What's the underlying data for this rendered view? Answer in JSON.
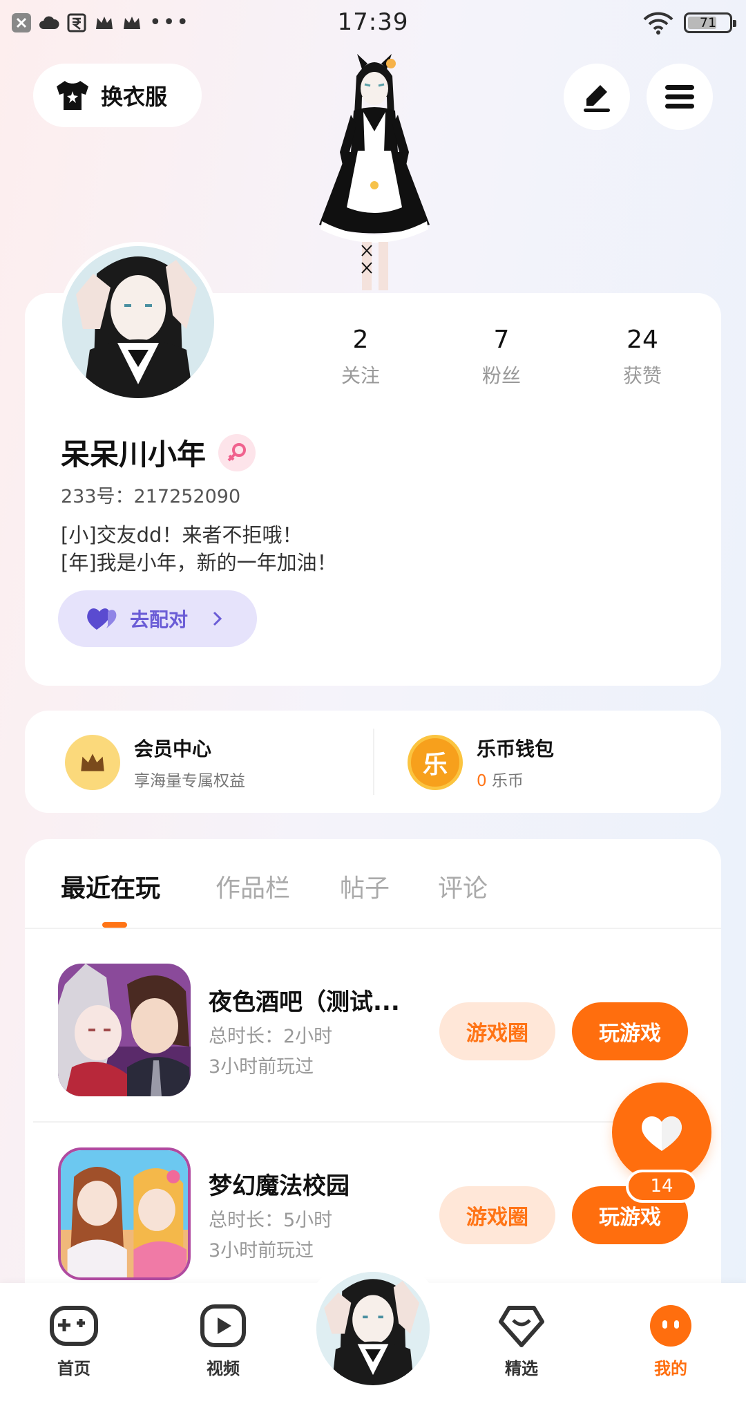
{
  "status_bar": {
    "time": "17:39",
    "battery": "71",
    "battery_level": 0.71,
    "left_icons": [
      "close-icon",
      "cloud-icon",
      "rupee-icon",
      "crown-icon",
      "crown-icon"
    ],
    "overflow": "•••"
  },
  "top": {
    "outfit_label": "换衣服",
    "edit_icon": "pencil-icon",
    "menu_icon": "menu-icon"
  },
  "profile": {
    "stats": [
      {
        "value": "2",
        "label": "关注"
      },
      {
        "value": "7",
        "label": "粉丝"
      },
      {
        "value": "24",
        "label": "获赞"
      }
    ],
    "nickname": "呆呆川小年",
    "gender_icon": "female-icon",
    "user_id": "233号：217252090",
    "bio_line1": "[小]交友dd！来者不拒哦！",
    "bio_line2": "[年]我是小年，新的一年加油！",
    "match_label": "去配对"
  },
  "member": {
    "vip_title": "会员中心",
    "vip_sub": "享海量专属权益",
    "wallet_title": "乐币钱包",
    "wallet_icon_text": "乐",
    "wallet_amount": "0",
    "wallet_unit": "乐币"
  },
  "tabs": [
    "最近在玩",
    "作品栏",
    "帖子",
    "评论"
  ],
  "games": [
    {
      "title": "夜色酒吧（测试...",
      "duration": "总时长：2小时",
      "last_played": "3小时前玩过",
      "circle_label": "游戏圈",
      "play_label": "玩游戏"
    },
    {
      "title": "梦幻魔法校园",
      "duration": "总时长：5小时",
      "last_played": "3小时前玩过",
      "circle_label": "游戏圈",
      "play_label": "玩游戏"
    }
  ],
  "like": {
    "count": "14"
  },
  "nav": [
    {
      "label": "首页",
      "icon": "gamepad-icon"
    },
    {
      "label": "视频",
      "icon": "play-icon"
    },
    {
      "label": "",
      "icon": "avatar"
    },
    {
      "label": "精选",
      "icon": "heart-diamond-icon"
    },
    {
      "label": "我的",
      "icon": "face-icon"
    }
  ],
  "colors": {
    "accent": "#ff6e0e",
    "accent_light": "#ffe7d8",
    "match_bg": "#e6e3fb",
    "match_text": "#6a5cd6"
  }
}
